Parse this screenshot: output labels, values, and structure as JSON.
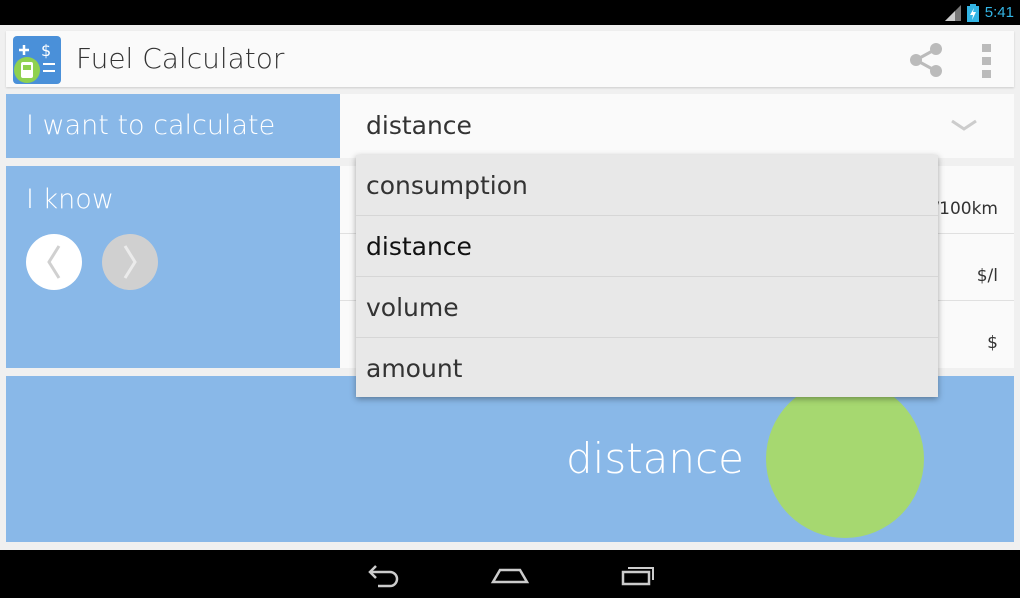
{
  "status_bar": {
    "time": "5:41",
    "icons": [
      "signal-icon",
      "battery-charging-icon"
    ]
  },
  "action_bar": {
    "title": "Fuel Calculator",
    "icons": [
      "fuel-calculator-app-icon",
      "share-icon",
      "overflow-menu-icon"
    ]
  },
  "calculate": {
    "label": "I want to calculate",
    "selected": "distance"
  },
  "know": {
    "label": "I know",
    "units": [
      "l/100km",
      "$/l",
      "$"
    ]
  },
  "dropdown": {
    "options": [
      "consumption",
      "distance",
      "volume",
      "amount"
    ],
    "selected_index": 1
  },
  "result": {
    "label": "distance"
  },
  "colors": {
    "panel_blue": "#89b8e8",
    "result_circle": "#a6d870",
    "accent": "#33b5e5"
  },
  "nav_bar": {
    "icons": [
      "back-icon",
      "home-icon",
      "recent-apps-icon"
    ]
  }
}
